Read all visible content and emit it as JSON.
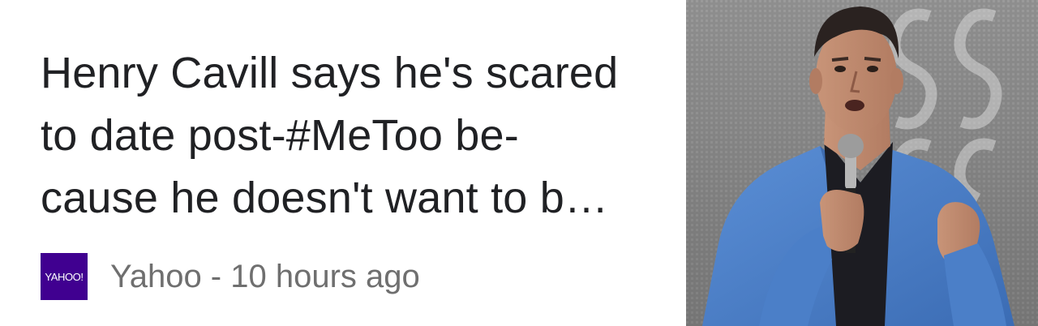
{
  "article": {
    "headline_lines": [
      "Henry Cavill says he's scared",
      "to date post-#MeToo be-",
      "cause he doesn't want to b…"
    ],
    "source_logo_text": "YAHOO!",
    "source_meta": "Yahoo - 10 hours ago",
    "thumbnail_icon": "news-photo-thumbnail"
  },
  "colors": {
    "logo_background": "#400090",
    "headline_text": "#202124",
    "meta_text": "#6f6f6f"
  }
}
